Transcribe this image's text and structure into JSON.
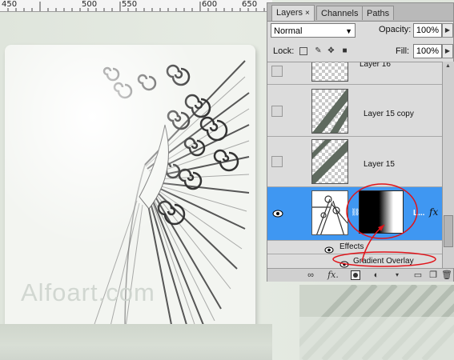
{
  "ruler": {
    "labels": [
      "450",
      "500",
      "550",
      "600",
      "650"
    ]
  },
  "canvas": {
    "watermark": "Alfoart.com"
  },
  "panel": {
    "tabs": [
      {
        "label": "Layers",
        "close": "×"
      },
      {
        "label": "Channels"
      },
      {
        "label": "Paths"
      }
    ],
    "blend_mode": "Normal",
    "opacity_label": "Opacity:",
    "opacity_value": "100%",
    "lock_label": "Lock:",
    "fill_label": "Fill:",
    "fill_value": "100%",
    "layers": [
      {
        "name": "Layer 16"
      },
      {
        "name": "Layer 15 copy"
      },
      {
        "name": "Layer 15"
      },
      {
        "name": "L...",
        "fx": "fx",
        "selected": true
      }
    ],
    "effects_label": "Effects",
    "gradient_overlay_label": "Gradient Overlay"
  },
  "colors": {
    "selection": "#3f97f2",
    "annotation": "#e0141a",
    "stripe": "#5f6a5f"
  },
  "icons": [
    "link-icon",
    "fx-icon",
    "mask-icon",
    "adjustment-icon",
    "folder-icon",
    "new-layer-icon",
    "trash-icon",
    "eye-icon",
    "lock-transparency-icon",
    "lock-paint-icon",
    "lock-move-icon",
    "lock-all-icon"
  ]
}
